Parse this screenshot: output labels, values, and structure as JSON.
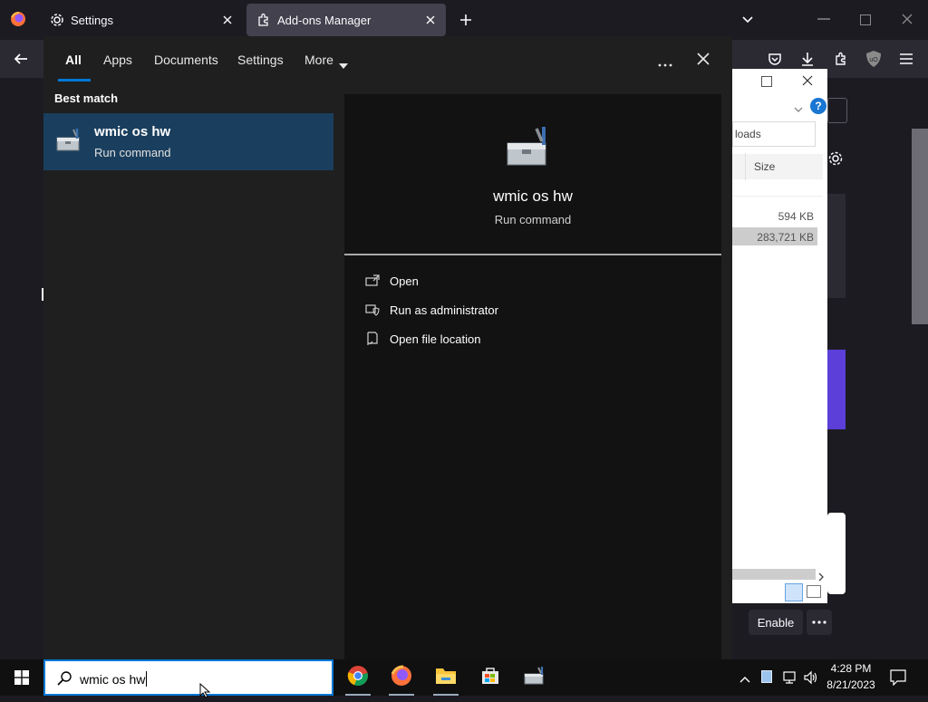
{
  "browser": {
    "tabs": [
      {
        "label": "Settings",
        "active": false,
        "icon": "gear-icon"
      },
      {
        "label": "Add-ons Manager",
        "active": true,
        "icon": "puzzle-icon"
      }
    ]
  },
  "explorer": {
    "path_fragment": "loads",
    "column_size": "Size",
    "sizes": [
      "594 KB",
      "283,721 KB"
    ]
  },
  "addons": {
    "enable_label": "Enable"
  },
  "search": {
    "filters": [
      "All",
      "Apps",
      "Documents",
      "Settings",
      "More"
    ],
    "active_filter": "All",
    "section_title": "Best match",
    "best_match": {
      "title": "wmic os hw",
      "subtitle": "Run command",
      "icon": "toolbox-icon"
    },
    "preview": {
      "title": "wmic os hw",
      "subtitle": "Run command"
    },
    "actions": [
      {
        "label": "Open",
        "icon": "open-icon"
      },
      {
        "label": "Run as administrator",
        "icon": "shield-icon"
      },
      {
        "label": "Open file location",
        "icon": "folder-location-icon"
      }
    ],
    "query": "wmic os hw"
  },
  "taskbar": {
    "apps": [
      "chrome-icon",
      "firefox-icon",
      "file-explorer-icon",
      "store-icon",
      "toolbox-icon"
    ],
    "time": "4:28 PM",
    "date": "8/21/2023"
  },
  "colors": {
    "accent": "#0078d7",
    "selected_row": "#1a3f5e",
    "panel_bg": "#1f1f1f",
    "preview_bg": "#121212"
  }
}
